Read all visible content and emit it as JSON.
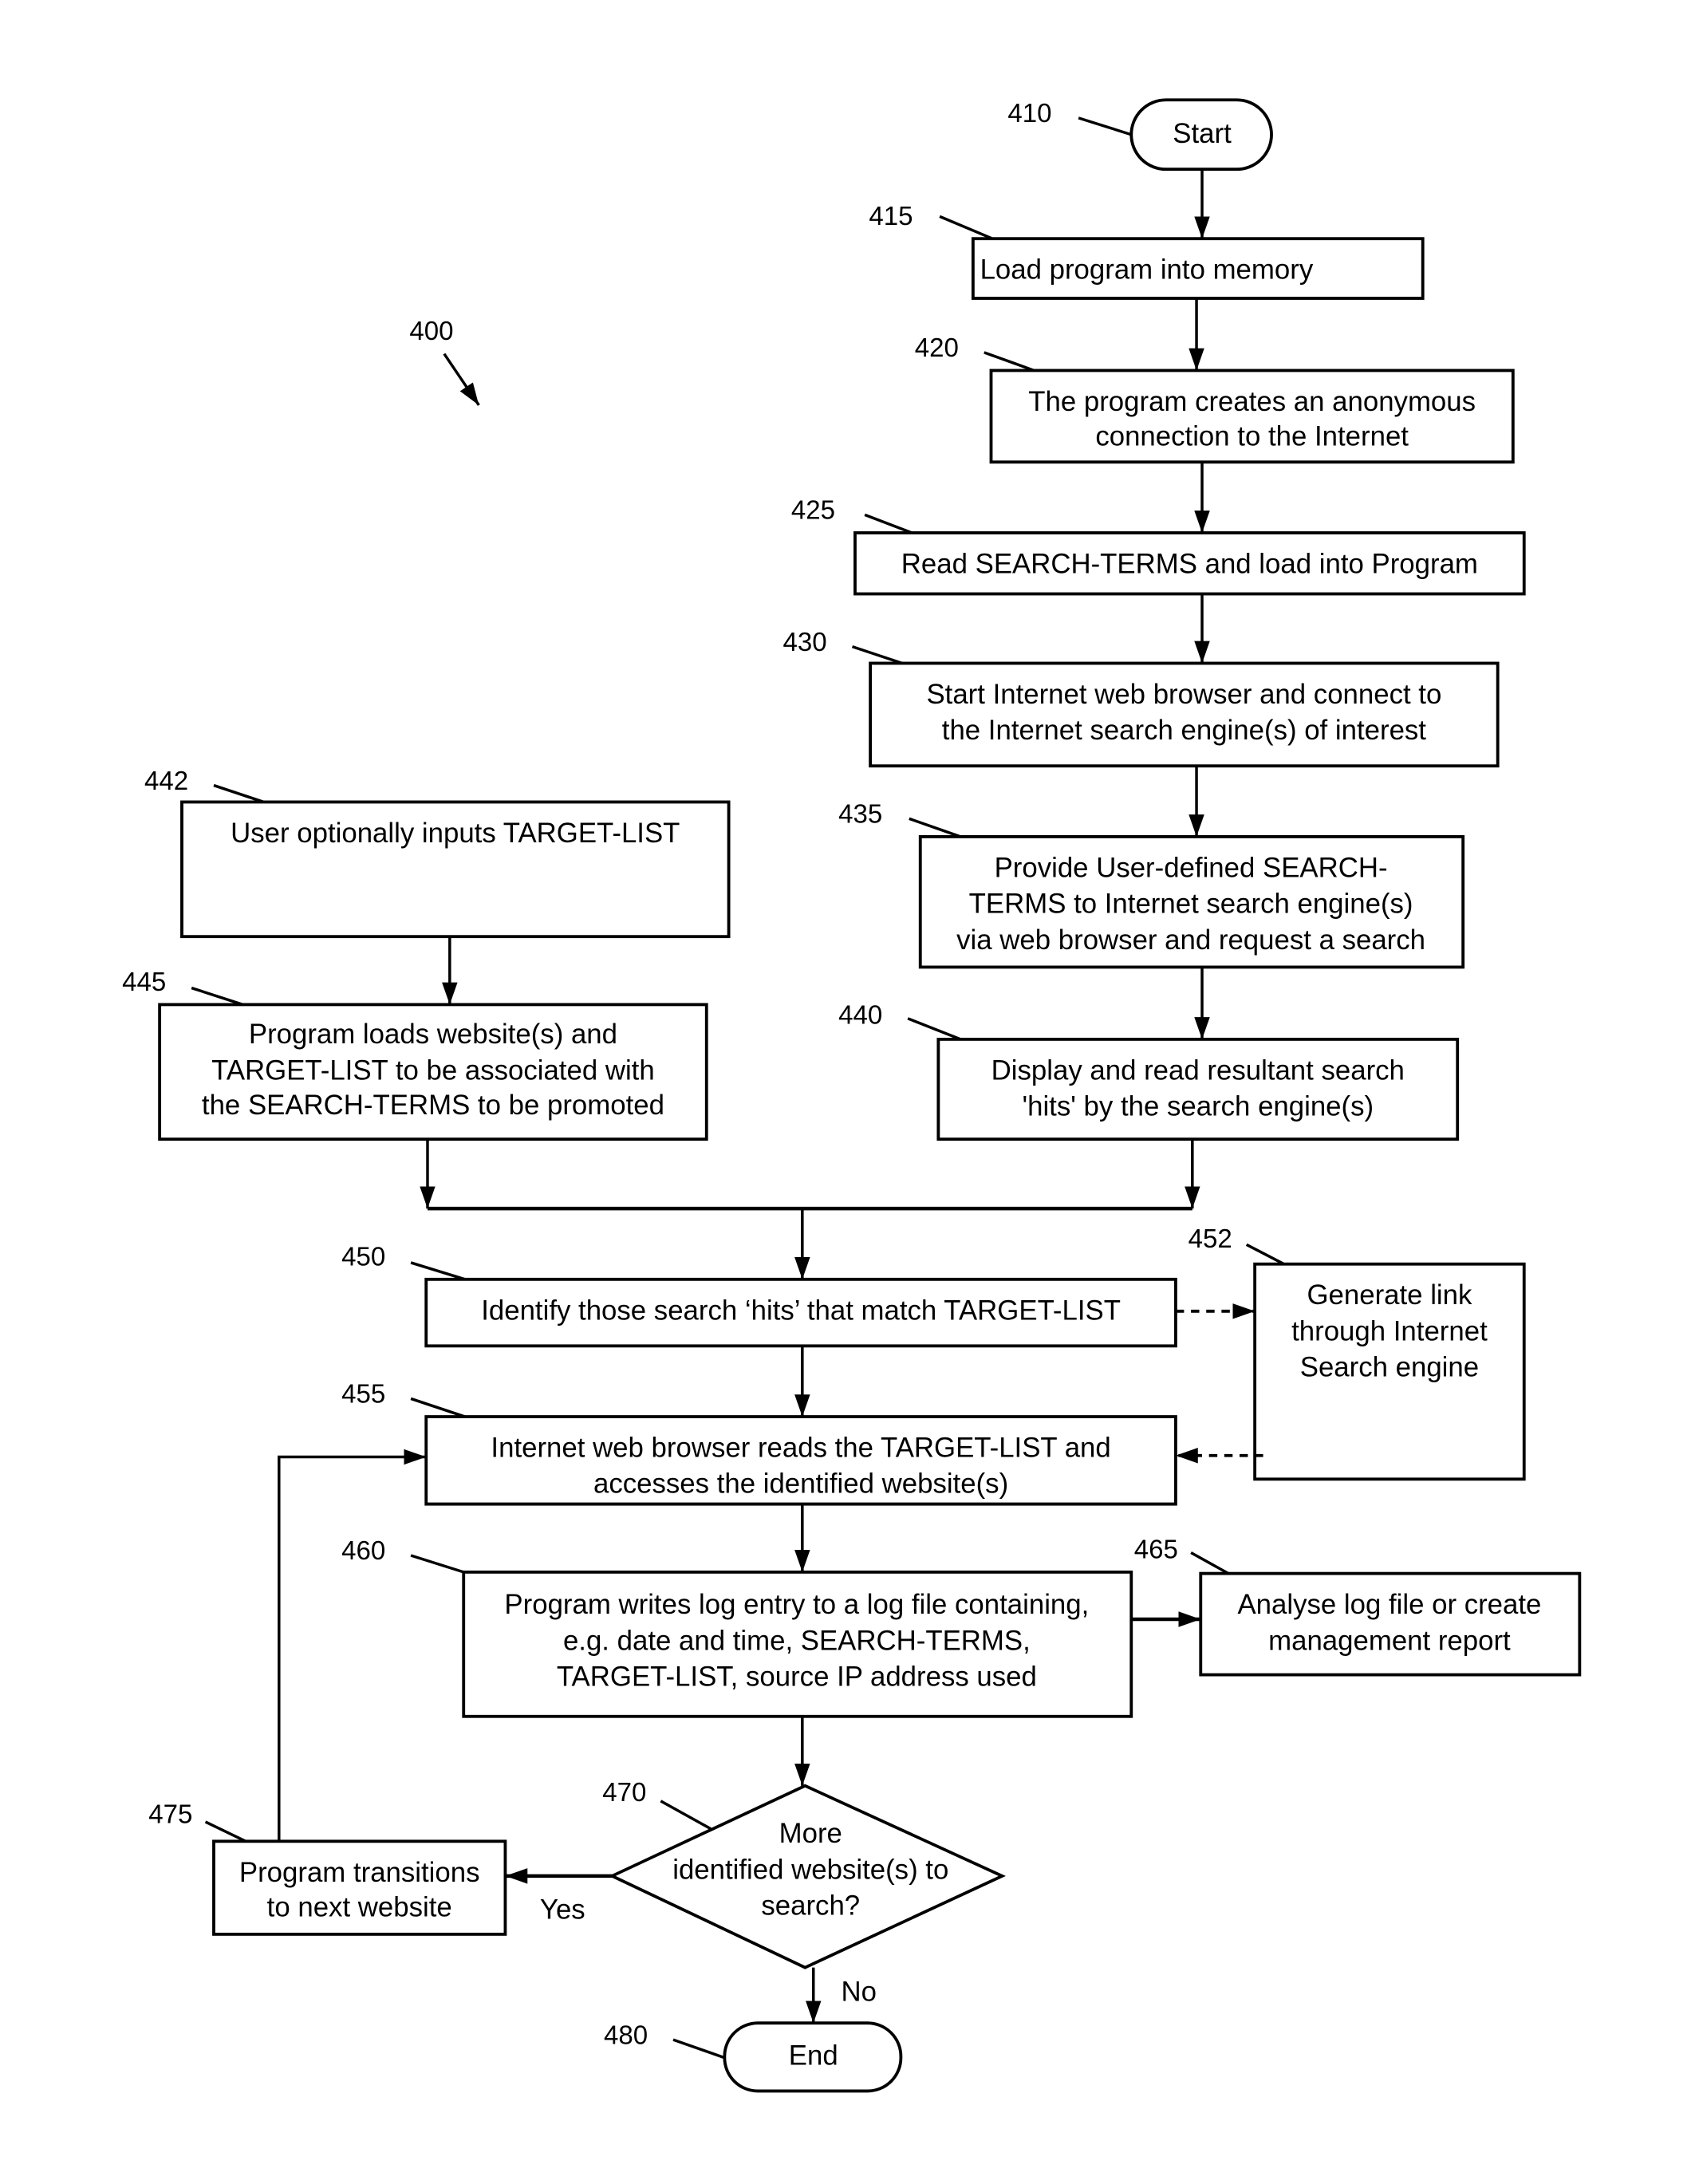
{
  "figure": {
    "reference": "400",
    "nodes": [
      {
        "id": "410",
        "type": "terminal",
        "lines": [
          "Start"
        ]
      },
      {
        "id": "415",
        "type": "process",
        "lines": [
          "Load program into memory"
        ]
      },
      {
        "id": "420",
        "type": "process",
        "lines": [
          "The program creates an anonymous",
          "connection to the Internet"
        ]
      },
      {
        "id": "425",
        "type": "process",
        "lines": [
          "Read SEARCH-TERMS and load into Program"
        ]
      },
      {
        "id": "430",
        "type": "process",
        "lines": [
          "Start Internet web browser and connect to",
          "the Internet search engine(s) of interest"
        ]
      },
      {
        "id": "435",
        "type": "process",
        "lines": [
          "Provide User-defined SEARCH-",
          "TERMS to Internet search engine(s)",
          "via web browser and request a search"
        ]
      },
      {
        "id": "440",
        "type": "process",
        "lines": [
          "Display and read resultant search",
          "'hits' by the search engine(s)"
        ]
      },
      {
        "id": "442",
        "type": "process",
        "lines": [
          "User optionally inputs TARGET-LIST"
        ]
      },
      {
        "id": "445",
        "type": "process",
        "lines": [
          "Program loads website(s) and",
          "TARGET-LIST to be associated with",
          "the SEARCH-TERMS to be promoted"
        ]
      },
      {
        "id": "450",
        "type": "process",
        "lines": [
          "Identify those search ‘hits’ that match TARGET-LIST"
        ]
      },
      {
        "id": "452",
        "type": "process",
        "lines": [
          "Generate link",
          "through Internet",
          "Search engine"
        ]
      },
      {
        "id": "455",
        "type": "process",
        "lines": [
          "Internet web browser reads the TARGET-LIST and",
          "accesses the identified website(s)"
        ]
      },
      {
        "id": "460",
        "type": "process",
        "lines": [
          "Program writes log entry to a log file containing,",
          "e.g. date and time, SEARCH-TERMS,",
          "TARGET-LIST, source IP address used"
        ]
      },
      {
        "id": "465",
        "type": "process",
        "lines": [
          "Analyse log file or create",
          "management report"
        ]
      },
      {
        "id": "470",
        "type": "decision",
        "lines": [
          "More",
          "identified website(s) to",
          "search?"
        ]
      },
      {
        "id": "475",
        "type": "process",
        "lines": [
          "Program transitions",
          "to next website"
        ]
      },
      {
        "id": "480",
        "type": "terminal",
        "lines": [
          "End"
        ]
      }
    ],
    "edges": [
      {
        "from": "410",
        "to": "415",
        "style": "solid"
      },
      {
        "from": "415",
        "to": "420",
        "style": "solid"
      },
      {
        "from": "420",
        "to": "425",
        "style": "solid"
      },
      {
        "from": "425",
        "to": "430",
        "style": "solid"
      },
      {
        "from": "430",
        "to": "435",
        "style": "solid"
      },
      {
        "from": "435",
        "to": "440",
        "style": "solid"
      },
      {
        "from": "442",
        "to": "445",
        "style": "solid"
      },
      {
        "from": "445",
        "to": "450",
        "style": "solid",
        "via": "merge"
      },
      {
        "from": "440",
        "to": "450",
        "style": "solid",
        "via": "merge"
      },
      {
        "from": "450",
        "to": "452",
        "style": "dashed"
      },
      {
        "from": "452",
        "to": "455",
        "style": "dashed"
      },
      {
        "from": "450",
        "to": "455",
        "style": "solid"
      },
      {
        "from": "455",
        "to": "460",
        "style": "solid"
      },
      {
        "from": "460",
        "to": "465",
        "style": "solid"
      },
      {
        "from": "460",
        "to": "470",
        "style": "solid"
      },
      {
        "from": "470",
        "to": "475",
        "style": "solid",
        "label": "Yes"
      },
      {
        "from": "475",
        "to": "455",
        "style": "solid"
      },
      {
        "from": "470",
        "to": "480",
        "style": "solid",
        "label": "No"
      }
    ],
    "edge_labels": {
      "yes": "Yes",
      "no": "No"
    }
  }
}
